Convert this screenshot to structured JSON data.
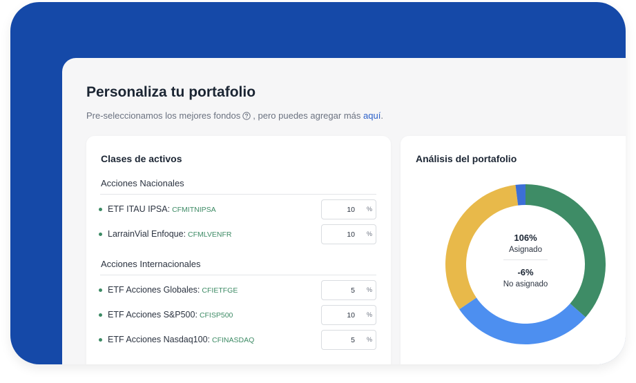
{
  "header": {
    "title": "Personaliza tu portafolio",
    "subtitle_before": "Pre-seleccionamos los mejores fondos",
    "subtitle_after": ", pero puedes agregar más",
    "link_text": "aquí",
    "subtitle_end": "."
  },
  "asset_classes": {
    "title": "Clases de activos",
    "sections": [
      {
        "label": "Acciones Nacionales",
        "funds": [
          {
            "name": "ETF ITAU IPSA:",
            "code": "CFMITNIPSA",
            "percent": "10",
            "unit": "%"
          },
          {
            "name": "LarrainVial Enfoque:",
            "code": "CFMLVENFR",
            "percent": "10",
            "unit": "%"
          }
        ]
      },
      {
        "label": "Acciones Internacionales",
        "funds": [
          {
            "name": "ETF Acciones Globales:",
            "code": "CFIETFGE",
            "percent": "5",
            "unit": "%"
          },
          {
            "name": "ETF Acciones S&P500:",
            "code": "CFISP500",
            "percent": "10",
            "unit": "%"
          },
          {
            "name": "ETF Acciones Nasdaq100:",
            "code": "CFINASDAQ",
            "percent": "5",
            "unit": "%"
          }
        ]
      }
    ]
  },
  "analysis": {
    "title": "Análisis del portafolio",
    "assigned_value": "106%",
    "assigned_label": "Asignado",
    "unassigned_value": "-6%",
    "unassigned_label": "No asignado",
    "segments": [
      {
        "color": "#3e8c66",
        "fraction": 0.365
      },
      {
        "color": "#4d8ff0",
        "fraction": 0.29
      },
      {
        "color": "#e8b94a",
        "fraction": 0.325
      },
      {
        "color": "#3c6fd6",
        "fraction": 0.02
      }
    ]
  },
  "colors": {
    "frame": "#1549a8",
    "accent_green": "#3c8a64",
    "link_blue": "#2a5fc9"
  }
}
